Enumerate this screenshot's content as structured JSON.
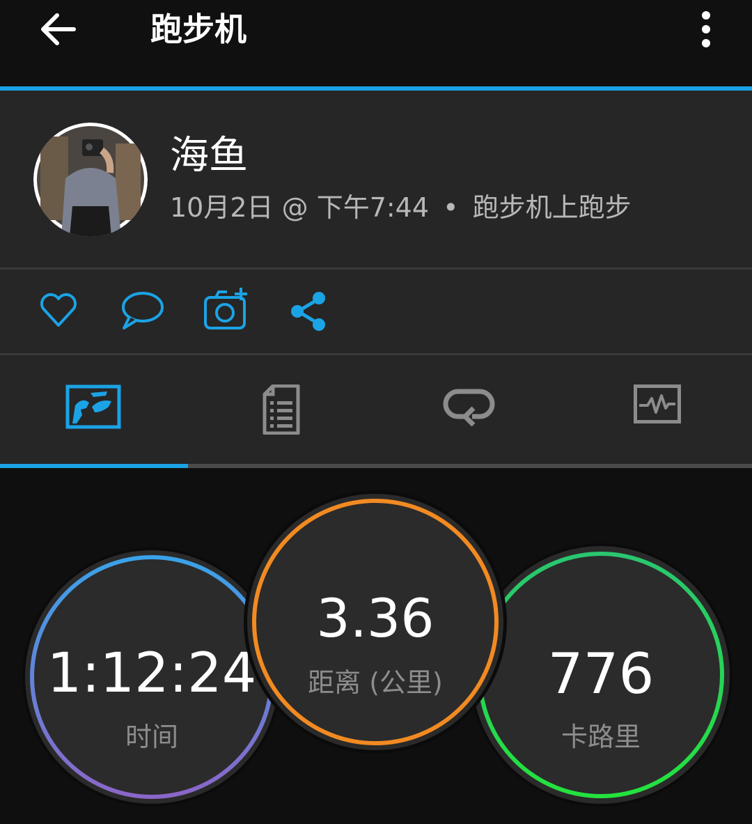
{
  "colors": {
    "accent": "#1ba3e6",
    "background": "#0f0f0f",
    "card": "#262626",
    "inactive_icon": "#8c8c8c",
    "ring_time_start": "#3aa2e8",
    "ring_time_end": "#8a66c8",
    "ring_distance": "#f28a22",
    "ring_calories_start": "#2ac670",
    "ring_calories_end": "#23e23d"
  },
  "header": {
    "title": "跑步机",
    "back_icon": "arrow-left-icon",
    "more_icon": "more-vertical-icon"
  },
  "activity": {
    "user_name": "海鱼",
    "date": "10月2日 @ 下午7:44",
    "separator": "•",
    "activity_type": "跑步机上跑步"
  },
  "actions": {
    "like_icon": "heart-icon",
    "comment_icon": "comment-icon",
    "add_photo_icon": "add-photo-icon",
    "share_icon": "share-icon"
  },
  "tabs": [
    {
      "icon": "map-icon",
      "active": true
    },
    {
      "icon": "document-list-icon",
      "active": false
    },
    {
      "icon": "laps-loop-icon",
      "active": false
    },
    {
      "icon": "chart-graph-icon",
      "active": false
    }
  ],
  "stats": {
    "time": {
      "value": "1:12:24",
      "label": "时间"
    },
    "distance": {
      "value": "3.36",
      "label": "距离 (公里)"
    },
    "calories": {
      "value": "776",
      "label": "卡路里"
    }
  }
}
